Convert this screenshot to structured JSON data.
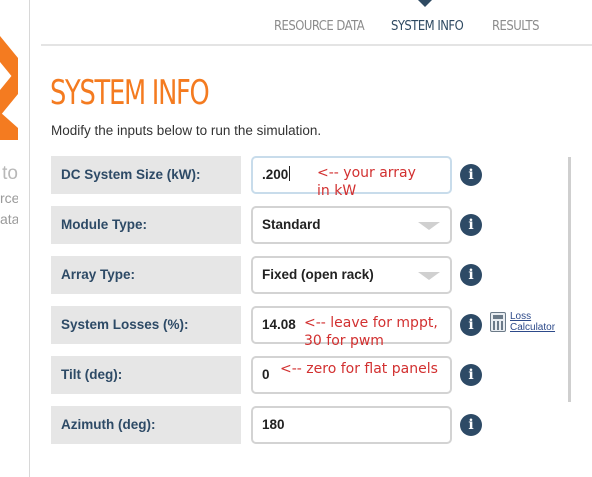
{
  "left_strip": {
    "text_lines": [
      "to",
      "rce",
      "ata"
    ],
    "logo_color": "#f47b20"
  },
  "nav": {
    "tabs": [
      {
        "label": "RESOURCE DATA",
        "active": false
      },
      {
        "label": "SYSTEM INFO",
        "active": true
      },
      {
        "label": "RESULTS",
        "active": false
      }
    ]
  },
  "page": {
    "title": "SYSTEM INFO",
    "subtitle": "Modify the inputs below to run the simulation."
  },
  "form": {
    "rows": [
      {
        "label": "DC System Size (kW):",
        "value": ".200",
        "type": "input"
      },
      {
        "label": "Module Type:",
        "value": "Standard",
        "type": "select"
      },
      {
        "label": "Array Type:",
        "value": "Fixed (open rack)",
        "type": "select"
      },
      {
        "label": "System Losses (%):",
        "value": "14.08",
        "type": "input"
      },
      {
        "label": "Tilt (deg):",
        "value": "0",
        "type": "input"
      },
      {
        "label": "Azimuth (deg):",
        "value": "180",
        "type": "input"
      }
    ],
    "info_icon": "i"
  },
  "loss_calculator": {
    "line1": "Loss",
    "line2": "Calculator"
  },
  "annotations": {
    "dc_size_1": "<-- your array",
    "dc_size_2": "in kW",
    "losses_1": "<-- leave for mppt,",
    "losses_2": "30 for pwm",
    "tilt": "<-- zero for flat panels"
  },
  "colors": {
    "accent": "#f47b20",
    "label_text": "#2d4a66",
    "label_bg": "#e6e6e6",
    "annotation": "#d23030"
  }
}
